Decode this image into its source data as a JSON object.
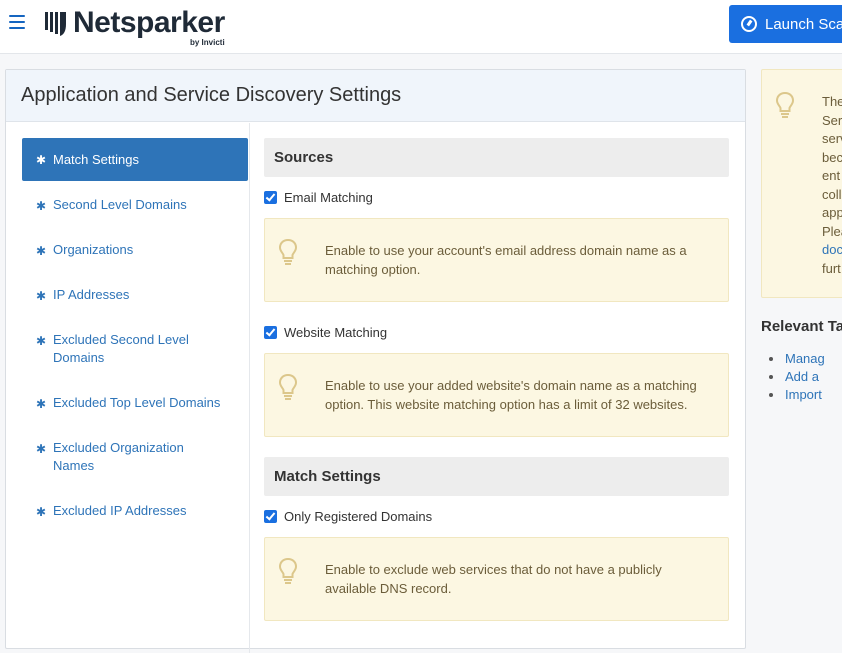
{
  "header": {
    "logo_text": "Netsparker",
    "logo_sub": "by Invicti",
    "launch_button": "Launch Scan"
  },
  "panel": {
    "title": "Application and Service Discovery Settings"
  },
  "sidebar": {
    "items": [
      {
        "label": "Match Settings",
        "active": true
      },
      {
        "label": "Second Level Domains"
      },
      {
        "label": "Organizations"
      },
      {
        "label": "IP Addresses"
      },
      {
        "label": "Excluded Second Level Domains"
      },
      {
        "label": "Excluded Top Level Domains"
      },
      {
        "label": "Excluded Organization Names"
      },
      {
        "label": "Excluded IP Addresses"
      }
    ]
  },
  "sources": {
    "heading": "Sources",
    "email_label": "Email Matching",
    "email_checked": true,
    "email_hint_1": "Enable to use your account's email address domain name as a",
    "email_hint_2": "matching option.",
    "website_label": "Website Matching",
    "website_checked": true,
    "website_hint_1": "Enable to use your added website's domain name as a matching",
    "website_hint_2": "option. This website matching option has a limit of 32 websites."
  },
  "match_settings": {
    "heading": "Match Settings",
    "registered_label": "Only Registered Domains",
    "registered_checked": true,
    "registered_hint_1": "Enable to exclude web services that do not have a publicly",
    "registered_hint_2": "available DNS record."
  },
  "right_panel": {
    "lines": [
      "The",
      "Ser",
      "serv",
      "bec",
      "ent",
      "coll",
      "app",
      "Plea",
      "doc",
      "furt"
    ],
    "relevant_title": "Relevant Ta",
    "relevant_items": [
      "Manag",
      "Add a",
      "Import"
    ]
  }
}
